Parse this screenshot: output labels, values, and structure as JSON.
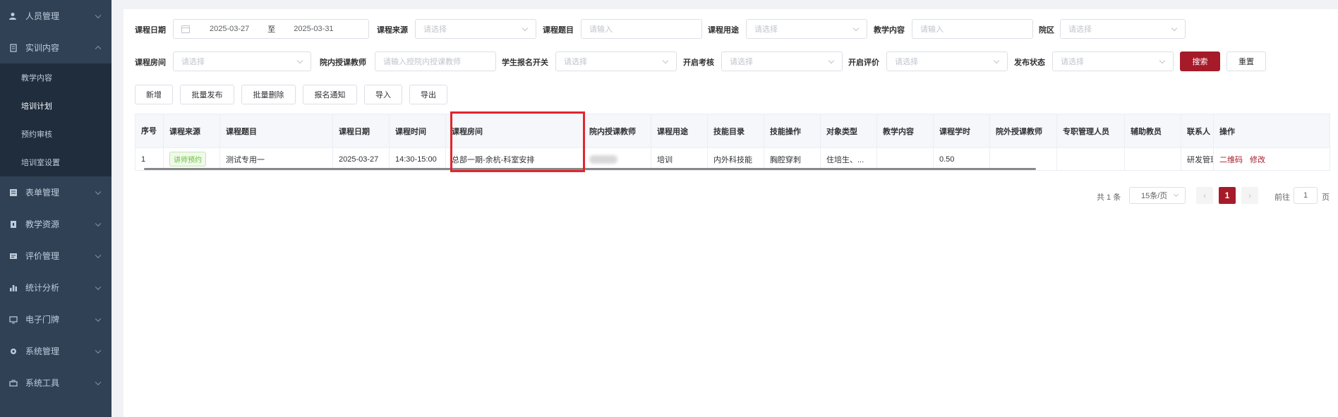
{
  "sidebar": {
    "top_menu": [
      {
        "label": "人员管理",
        "icon": "user-icon"
      }
    ],
    "open_menu": {
      "label": "实训内容",
      "icon": "document-icon"
    },
    "submenu": [
      {
        "label": "教学内容"
      },
      {
        "label": "培训计划",
        "active": true
      },
      {
        "label": "预约审核"
      },
      {
        "label": "培训室设置"
      }
    ],
    "bottom_menu": [
      {
        "label": "表单管理",
        "icon": "form-icon"
      },
      {
        "label": "教学资源",
        "icon": "resource-icon"
      },
      {
        "label": "评价管理",
        "icon": "evaluation-icon"
      },
      {
        "label": "统计分析",
        "icon": "bar-chart-icon"
      },
      {
        "label": "电子门牌",
        "icon": "monitor-icon"
      },
      {
        "label": "系统管理",
        "icon": "gear-icon"
      },
      {
        "label": "系统工具",
        "icon": "toolbox-icon"
      }
    ]
  },
  "filters": {
    "course_date": {
      "label": "课程日期",
      "start": "2025-03-27",
      "sep": "至",
      "end": "2025-03-31"
    },
    "course_source": {
      "label": "课程来源",
      "placeholder": "请选择"
    },
    "course_title": {
      "label": "课程题目",
      "placeholder": "请输入"
    },
    "course_purpose": {
      "label": "课程用途",
      "placeholder": "请选择"
    },
    "teaching_content": {
      "label": "教学内容",
      "placeholder": "请输入"
    },
    "campus": {
      "label": "院区",
      "placeholder": "请选择"
    },
    "course_room": {
      "label": "课程房间",
      "placeholder": "请选择"
    },
    "inner_teacher": {
      "label": "院内授课教师",
      "placeholder": "请输入授院内授课教师"
    },
    "student_signup": {
      "label": "学生报名开关",
      "placeholder": "请选择"
    },
    "open_exam": {
      "label": "开启考核",
      "placeholder": "请选择"
    },
    "open_eval": {
      "label": "开启评价",
      "placeholder": "请选择"
    },
    "publish_status": {
      "label": "发布状态",
      "placeholder": "请选择"
    },
    "search_label": "搜索",
    "reset_label": "重置"
  },
  "toolbar": {
    "add": "新增",
    "batch_publish": "批量发布",
    "batch_delete": "批量删除",
    "signup_notice": "报名通知",
    "import": "导入",
    "export": "导出"
  },
  "table": {
    "columns": [
      "序号",
      "课程来源",
      "课程题目",
      "课程日期",
      "课程时间",
      "课程房间",
      "院内授课教师",
      "课程用途",
      "技能目录",
      "技能操作",
      "对象类型",
      "教学内容",
      "课程学时",
      "院外授课教师",
      "专职管理人员",
      "辅助教员",
      "联系人",
      "操作"
    ],
    "rows": [
      {
        "index": "1",
        "source": "讲师预约",
        "title": "测试专用一",
        "date": "2025-03-27",
        "time": "14:30-15:00",
        "room": "总部一期-余杭-科室安排",
        "inner_teacher": "",
        "purpose": "培训",
        "skill_catalog": "内外科技能",
        "skill_op": "胸腔穿刺",
        "target_type": "住培生、...",
        "content": "",
        "hours": "0.50",
        "outer_teacher": "",
        "manager": "",
        "assistant": "",
        "contact": "研发管理",
        "actions": [
          "二维码",
          "修改"
        ]
      }
    ]
  },
  "pagination": {
    "total": "共 1 条",
    "page_size": "15条/页",
    "current": "1",
    "goto_label": "前往",
    "goto_value": "1",
    "page_suffix": "页"
  },
  "colors": {
    "sidebar_bg": "#304156",
    "primary": "#a61b29",
    "highlight": "#e0262f"
  }
}
